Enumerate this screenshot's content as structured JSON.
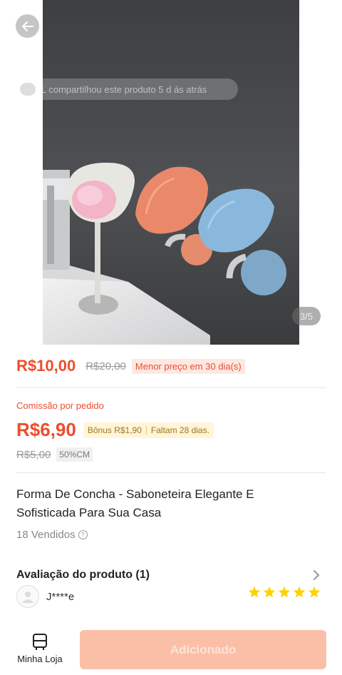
{
  "hero": {
    "back_icon": "arrow-left-icon",
    "share_text": "L compartilhou este produto 5 d ás atrás",
    "share_avatar": "",
    "page_indicator": "3/5"
  },
  "price": {
    "current": "R$10,00",
    "original": "R$20,00",
    "badge": "Menor preço em 30 dia(s)"
  },
  "commission": {
    "label": "Comissão por pedido",
    "value": "R$6,90",
    "bonus": "Bônus R$1,90",
    "remaining": "Faltam 28 dias.",
    "original": "R$5,00",
    "cm_badge": "50%CM"
  },
  "product": {
    "title": "Forma De Concha - Saboneteira Elegante E Sofisticada Para Sua Casa",
    "sold": "18 Vendidos"
  },
  "review": {
    "title": "Avaliação do produto (1)",
    "reviewer": "J****e",
    "stars": 5
  },
  "bottom": {
    "shop_label": "Minha Loja",
    "add_button": "Adicionado"
  },
  "colors": {
    "accent": "#ee4d2d",
    "star": "#ffd200",
    "add_button": "#fbbfa8"
  }
}
